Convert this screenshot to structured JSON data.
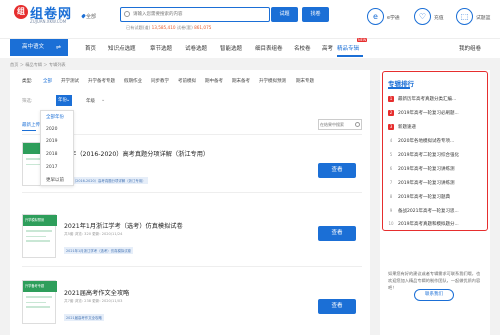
{
  "header": {
    "logo_mark": "组",
    "logo_text": "组卷网",
    "logo_sub": "ZUJUAN.XKW.COM",
    "region": "全部",
    "search_placeholder": "请输入您需要搜索的内容",
    "search_label": "试题",
    "find_label": "找卷",
    "stats_prefix": "已有试题(道)",
    "stats_questions": "13,585,410",
    "stats_mid": "试卷(套)",
    "stats_papers": "861,075",
    "links": [
      {
        "icon": "e",
        "label": "e学通"
      },
      {
        "icon": "♡",
        "label": "充值"
      },
      {
        "icon": "⬚",
        "label": "试题篮"
      }
    ]
  },
  "nav": {
    "class_button": "高中语文",
    "class_arrow": "⇌",
    "items": [
      "首页",
      "知识点选题",
      "章节选题",
      "试卷选题",
      "智能选题",
      "细目表组卷",
      "名校卷",
      "高考",
      "精品专辑"
    ],
    "active": "精品专辑",
    "badge": "NEW",
    "right": "我的组卷"
  },
  "breadcrumb": "首页  ＞  精品专辑  ＞  专辑列表",
  "filters": {
    "row1_label": "类型:",
    "row1_items": [
      "全部",
      "开学测试",
      "升学备考专题",
      "假期作业",
      "同步教学",
      "考前模拟",
      "期中备考",
      "期末备考",
      "升学模拟预测",
      "期末专题"
    ],
    "row2_label": "筛选:",
    "year_label": "年份",
    "grade_label": "年级",
    "year_options": [
      "全部年份",
      "2020",
      "2019",
      "2018",
      "2017",
      "更早以前"
    ],
    "sort_label": "最新上传",
    "list_search_placeholder": "在结果中搜索"
  },
  "cards": [
    {
      "thumb_title": "",
      "title": "五年（2016-2020）高考真题分项详解（浙江专用）",
      "meta": "",
      "tags": [
        "五年（2016-2020）高考真题分项详解（浙江专用）"
      ],
      "button": "查看"
    },
    {
      "thumb_title": "升学模拟预测",
      "title": "2021年1月浙江学考（选考）仿真模拟试卷",
      "meta": "共5套  浏览: 320  更新: 2020/11/24",
      "tags": [
        "2021年1月浙江学考（选考）仿真模拟试卷"
      ],
      "button": "查看"
    },
    {
      "thumb_title": "升学备考专题",
      "title": "2021届高考作文全攻略",
      "meta": "共7套  浏览: 238  更新: 2020/11/03",
      "tags": [
        "2021届高考作文全攻略"
      ],
      "button": "查看"
    }
  ],
  "sidebar": {
    "title": "专辑排行",
    "ranks": [
      "最新历年高考真题分类汇编...",
      "2019年高考一轮复习必刷题...",
      "新题速递",
      "2020年各地模拟试卷专项...",
      "2019年高考二轮复习综合强化",
      "2019年高考一轮复习讲练测",
      "2019年高考一轮复习讲练测",
      "2019年高考一轮复习题典",
      "备战2021年高考一轮复习思...",
      "2019年高考真题和模拟题分..."
    ],
    "note": "如果您有好的建议或者专辑需求可联系我们哦，也欢迎您加入精品专辑的制作团队，一起做优质内容吧！",
    "contact": "联系我们"
  },
  "colors": {
    "primary": "#1b6fd6",
    "accent_red": "#e62e2e",
    "thumb_green": "#2e9e5b"
  }
}
